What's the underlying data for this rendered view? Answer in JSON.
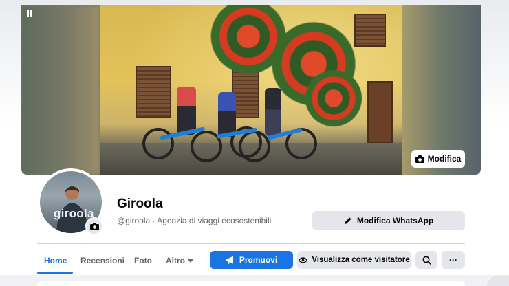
{
  "page": {
    "name": "Giroola",
    "handle_line": "@giroola · Agenzia di viaggi ecosostenibili",
    "avatar_logo": "giroola"
  },
  "cover": {
    "edit_label": "Modifica",
    "icons": {
      "pause": "pause-icon",
      "camera": "camera-icon"
    }
  },
  "actions": {
    "whatsapp_label": "Modifica WhatsApp",
    "whatsapp_icon": "pencil-icon"
  },
  "tabs": [
    {
      "label": "Home",
      "active": true
    },
    {
      "label": "Recensioni",
      "active": false
    },
    {
      "label": "Foto",
      "active": false
    },
    {
      "label": "Altro",
      "active": false
    }
  ],
  "toolbar": {
    "promote_label": "Promuovi",
    "promote_icon": "megaphone-icon",
    "visitor_label": "Visualizza come visitatore",
    "visitor_icon": "eye-icon",
    "search_icon": "search-icon",
    "more_label": "···"
  },
  "colors": {
    "accent": "#1b74e4",
    "button_gray": "#e4e6eb",
    "secondary_text": "#65676b"
  }
}
